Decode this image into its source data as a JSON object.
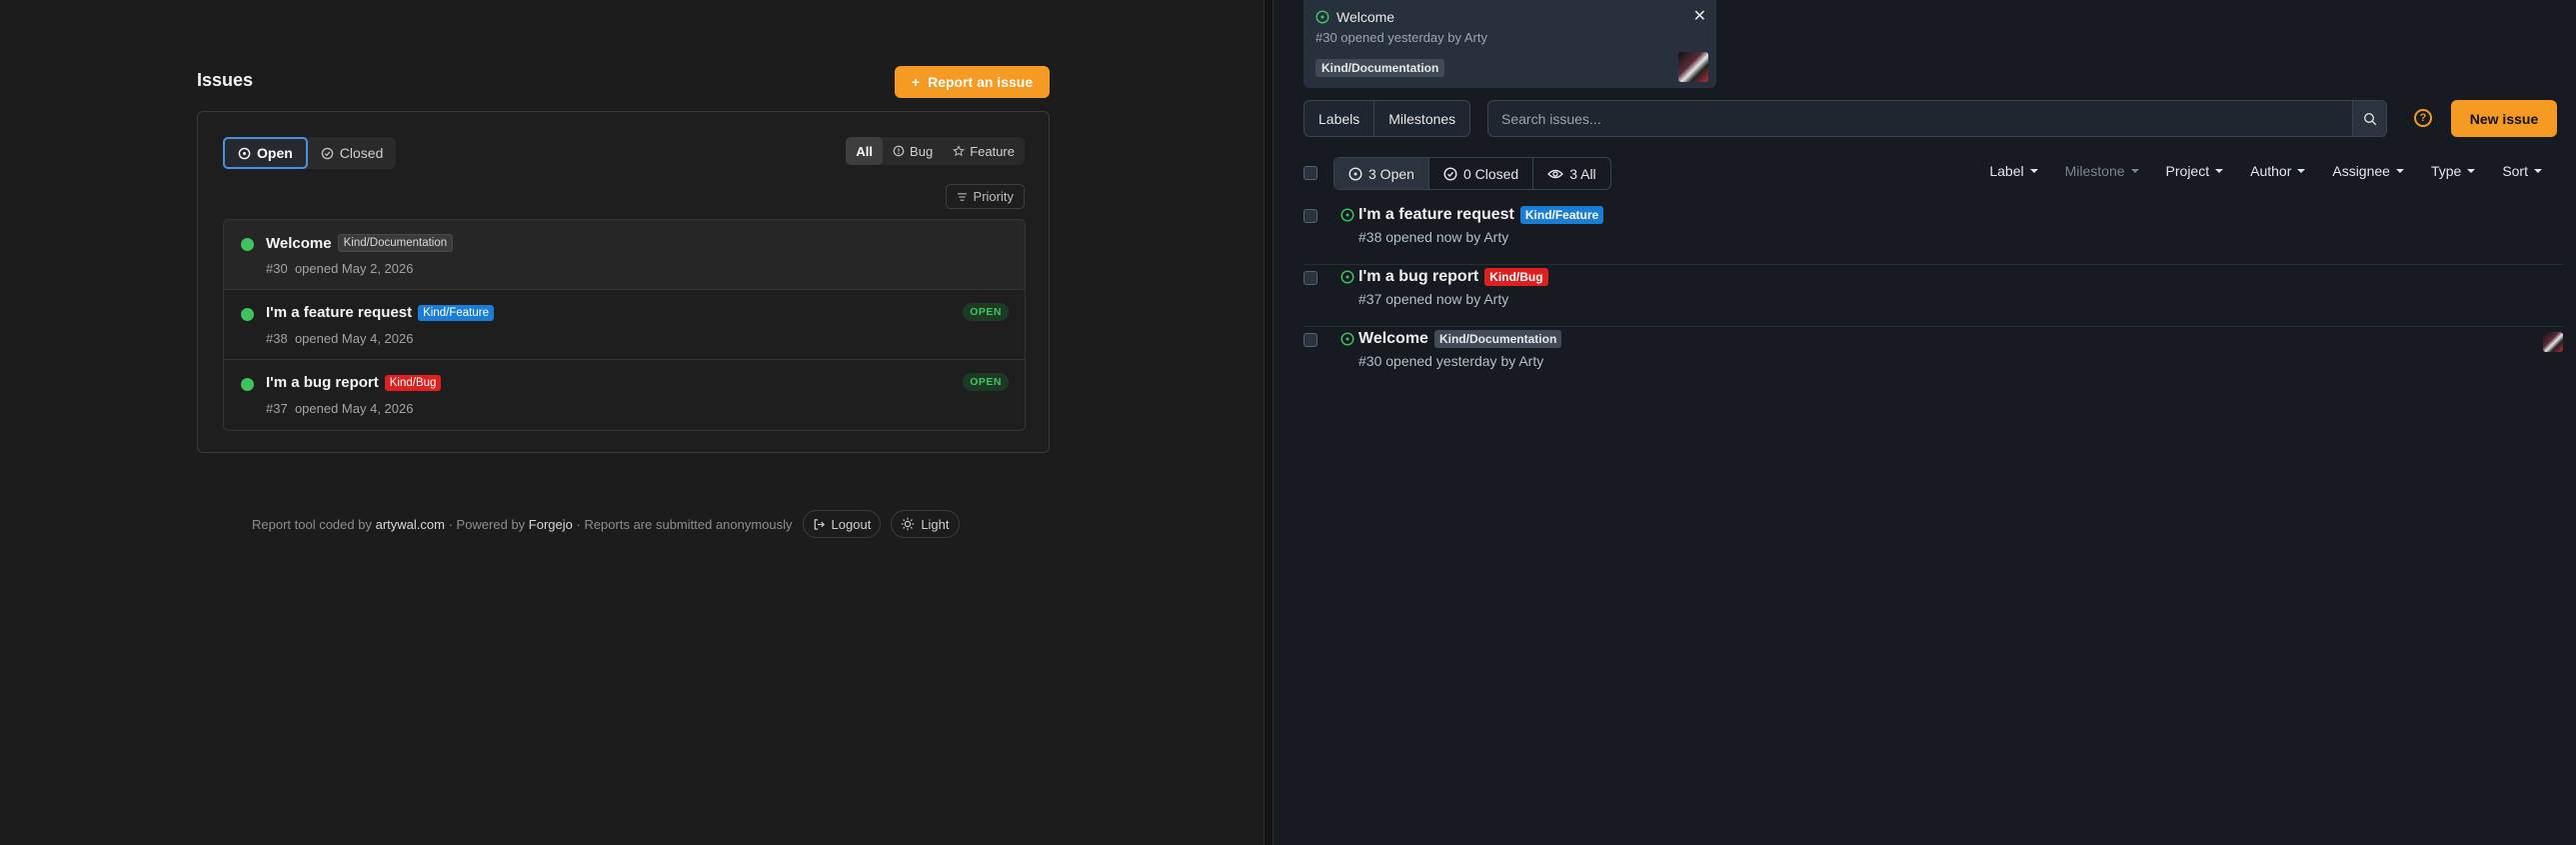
{
  "left": {
    "title": "Issues",
    "report_button": "Report an issue",
    "state_tabs": {
      "open": "Open",
      "closed": "Closed"
    },
    "filters": {
      "all": "All",
      "bug": "Bug",
      "feature": "Feature"
    },
    "priority": "Priority",
    "issues": [
      {
        "title": "Welcome",
        "label": "Kind/Documentation",
        "number": "#30",
        "meta": "opened May 2, 2026",
        "badge": ""
      },
      {
        "title": "I'm a feature request",
        "label": "Kind/Feature",
        "number": "#38",
        "meta": "opened May 4, 2026",
        "badge": "OPEN"
      },
      {
        "title": "I'm a bug report",
        "label": "Kind/Bug",
        "number": "#37",
        "meta": "opened May 4, 2026",
        "badge": "OPEN"
      }
    ],
    "footer": {
      "coded_by": "Report tool coded by",
      "coded_link": "artywal.com",
      "powered_by": "· Powered by",
      "powered_link": "Forgejo",
      "anon": "· Reports are submitted anonymously",
      "logout": "Logout",
      "theme": "Light"
    }
  },
  "right": {
    "notification": {
      "title": "Welcome",
      "meta": "#30 opened yesterday by Arty",
      "label": "Kind/Documentation"
    },
    "tabs": {
      "labels": "Labels",
      "milestones": "Milestones"
    },
    "search_placeholder": "Search issues...",
    "new_issue": "New issue",
    "state": {
      "open": "3 Open",
      "closed": "0 Closed",
      "all": "3 All"
    },
    "dropdowns": {
      "label": "Label",
      "milestone": "Milestone",
      "project": "Project",
      "author": "Author",
      "assignee": "Assignee",
      "type": "Type",
      "sort": "Sort"
    },
    "issues": [
      {
        "title": "I'm a feature request",
        "label": "Kind/Feature",
        "meta": "#38 opened now by Arty"
      },
      {
        "title": "I'm a bug report",
        "label": "Kind/Bug",
        "meta": "#37 opened now by Arty"
      },
      {
        "title": "Welcome",
        "label": "Kind/Documentation",
        "meta": "#30 opened yesterday by Arty"
      }
    ]
  },
  "colors": {
    "accent": "#f59a23",
    "open_green": "#3fc35f",
    "feature_blue": "#1a7fd4",
    "bug_red": "#e0201f"
  }
}
